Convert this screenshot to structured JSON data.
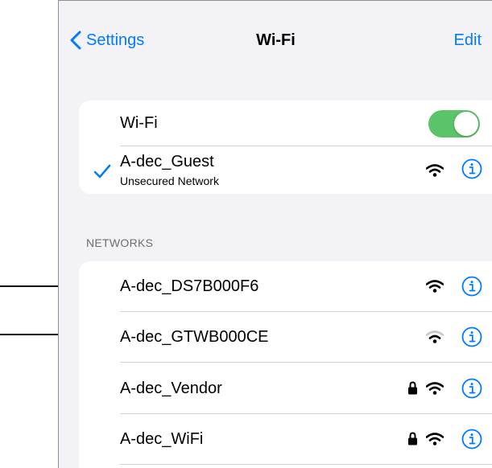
{
  "nav": {
    "back_label": "Settings",
    "title": "Wi-Fi",
    "edit_label": "Edit"
  },
  "wifi_toggle": {
    "label": "Wi-Fi",
    "state": "on",
    "color": "#5ac468"
  },
  "current_network": {
    "name": "A-dec_Guest",
    "subtitle": "Unsecured Network"
  },
  "networks_header": "NETWORKS",
  "networks": [
    {
      "name": "A-dec_DS7B000F6",
      "locked": false
    },
    {
      "name": "A-dec_GTWB000CE",
      "locked": false
    },
    {
      "name": "A-dec_Vendor",
      "locked": true
    },
    {
      "name": "A-dec_WiFi",
      "locked": true
    }
  ],
  "colors": {
    "accent": "#007aff",
    "toggle_on": "#5ac468",
    "background": "#f2f2f7"
  }
}
